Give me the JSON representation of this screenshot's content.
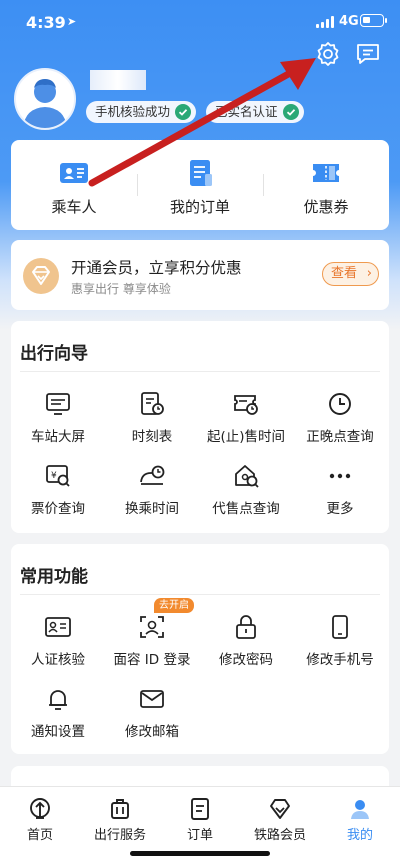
{
  "status_bar": {
    "time": "4:39",
    "network": "4G"
  },
  "profile": {
    "badges": [
      {
        "label": "手机核验成功"
      },
      {
        "label": "已实名认证"
      }
    ]
  },
  "quick_actions": [
    {
      "label": "乘车人",
      "icon": "passenger-card-icon"
    },
    {
      "label": "我的订单",
      "icon": "order-document-icon"
    },
    {
      "label": "优惠券",
      "icon": "coupon-icon"
    }
  ],
  "member": {
    "title": "开通会员，立享积分优惠",
    "subtitle": "惠享出行 尊享体验",
    "button_label": "查看",
    "button_chevron": "›"
  },
  "travel_guide": {
    "title": "出行向导",
    "items": [
      {
        "label": "车站大屏",
        "icon": "station-screen-icon"
      },
      {
        "label": "时刻表",
        "icon": "timetable-icon"
      },
      {
        "label": "起(止)售时间",
        "icon": "sale-time-icon"
      },
      {
        "label": "正晚点查询",
        "icon": "clock-icon"
      },
      {
        "label": "票价查询",
        "icon": "fare-search-icon"
      },
      {
        "label": "换乘时间",
        "icon": "transfer-time-icon"
      },
      {
        "label": "代售点查询",
        "icon": "agency-search-icon"
      },
      {
        "label": "更多",
        "icon": "more-dots-icon"
      }
    ]
  },
  "common_functions": {
    "title": "常用功能",
    "items": [
      {
        "label": "人证核验",
        "icon": "id-card-icon"
      },
      {
        "label": "面容 ID 登录",
        "icon": "face-id-icon",
        "tag": "去开启"
      },
      {
        "label": "修改密码",
        "icon": "lock-icon"
      },
      {
        "label": "修改手机号",
        "icon": "phone-icon"
      },
      {
        "label": "通知设置",
        "icon": "bell-icon"
      },
      {
        "label": "修改邮箱",
        "icon": "mail-icon"
      }
    ]
  },
  "bottom_nav": {
    "items": [
      {
        "label": "首页",
        "icon": "railway-logo-icon"
      },
      {
        "label": "出行服务",
        "icon": "luggage-icon"
      },
      {
        "label": "订单",
        "icon": "order-icon"
      },
      {
        "label": "铁路会员",
        "icon": "diamond-icon"
      },
      {
        "label": "我的",
        "icon": "person-icon",
        "active": true
      }
    ]
  },
  "colors": {
    "brand_blue": "#3a8df2",
    "accent_orange": "#e8762c",
    "success_green": "#2aa876",
    "annotation_red": "#c8201f"
  }
}
